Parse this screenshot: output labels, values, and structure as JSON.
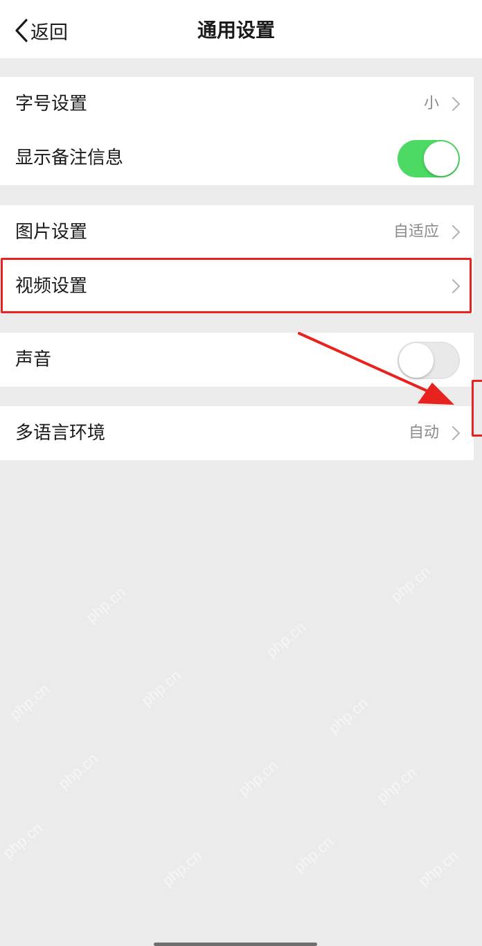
{
  "nav": {
    "back_label": "返回",
    "title": "通用设置"
  },
  "groups": [
    {
      "rows": [
        {
          "label": "字号设置",
          "value": "小",
          "control": "chevron"
        },
        {
          "label": "显示备注信息",
          "control": "toggle",
          "on": true
        }
      ]
    },
    {
      "rows": [
        {
          "label": "图片设置",
          "value": "自适应",
          "control": "chevron"
        },
        {
          "label": "视频设置",
          "value": "",
          "control": "chevron"
        }
      ]
    },
    {
      "rows": [
        {
          "label": "声音",
          "control": "toggle",
          "on": false
        }
      ]
    },
    {
      "rows": [
        {
          "label": "多语言环境",
          "value": "自动",
          "control": "chevron"
        }
      ]
    }
  ],
  "watermark": "php.cn",
  "colors": {
    "toggle_on": "#4cd964",
    "annotation": "#e8231f",
    "background": "#ebebeb"
  }
}
